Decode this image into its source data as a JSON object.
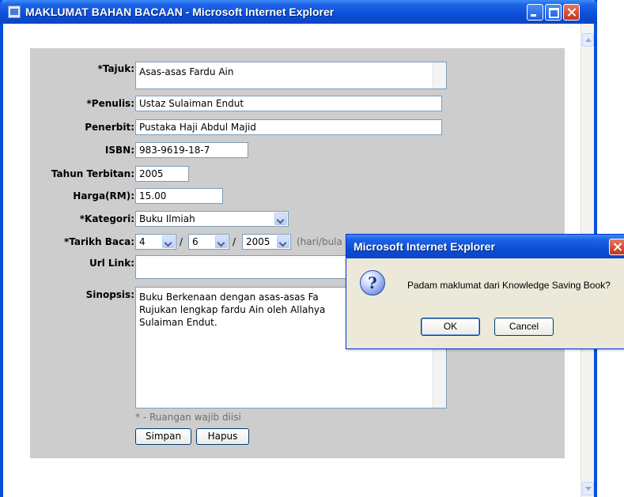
{
  "window": {
    "title": "MAKLUMAT BAHAN BACAAN - Microsoft Internet Explorer"
  },
  "form": {
    "tajuk": {
      "label": "*Tajuk:",
      "value": "Asas-asas Fardu Ain"
    },
    "penulis": {
      "label": "*Penulis:",
      "value": "Ustaz Sulaiman Endut"
    },
    "penerbit": {
      "label": "Penerbit:",
      "value": "Pustaka Haji Abdul Majid"
    },
    "isbn": {
      "label": "ISBN:",
      "value": "983-9619-18-7"
    },
    "tahun": {
      "label": "Tahun Terbitan:",
      "value": "2005"
    },
    "harga": {
      "label": "Harga(RM):",
      "value": "15.00"
    },
    "kategori": {
      "label": "*Kategori:",
      "value": "Buku Ilmiah"
    },
    "tarikh": {
      "label": "*Tarikh Baca:",
      "day": "4",
      "month": "6",
      "year": "2005",
      "sep": "/",
      "hint": "(hari/bula"
    },
    "url": {
      "label": "Url Link:",
      "value": ""
    },
    "sinopsis": {
      "label": "Sinopsis:",
      "line1": "Buku Berkenaan dengan asas-asas Fa",
      "line2": "Rujukan lengkap fardu Ain oleh Allahya",
      "line3": "Sulaiman Endut."
    },
    "note": "* - Ruangan wajib diisi",
    "simpan_label": "Simpan",
    "hapus_label": "Hapus"
  },
  "dialog": {
    "title": "Microsoft Internet Explorer",
    "message": "Padam maklumat dari Knowledge Saving Book?",
    "icon_glyph": "?",
    "ok_label": "OK",
    "cancel_label": "Cancel"
  },
  "colors": {
    "titlebar": "#0a4fd8",
    "panel": "#cdcdcd",
    "dialog_bg": "#ece9d8"
  }
}
